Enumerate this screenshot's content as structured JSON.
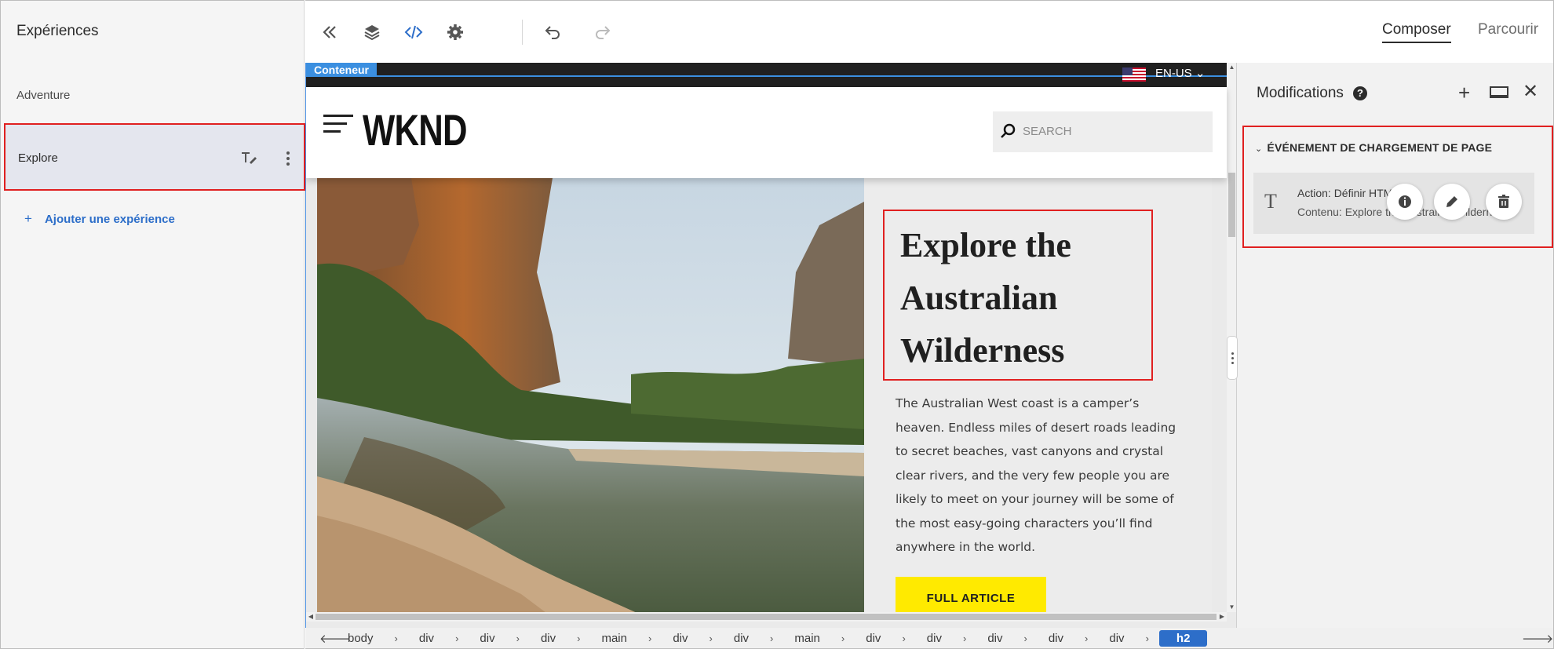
{
  "left_panel": {
    "title": "Expériences",
    "experiences": [
      "Adventure",
      "Explore"
    ],
    "add_label": "Ajouter une expérience"
  },
  "toolbar": {
    "icons": [
      "collapse-icon",
      "layers-icon",
      "code-icon",
      "settings-icon",
      "undo-icon",
      "redo-icon"
    ],
    "tabs": {
      "compose": "Composer",
      "browse": "Parcourir"
    }
  },
  "canvas": {
    "container_tag": "Conteneur",
    "language": "EN-US",
    "site": {
      "logo": "WKND",
      "search_placeholder": "SEARCH",
      "headline": "Explore the Australian Wilderness",
      "body": "The Australian West coast is a camper’s heaven. Endless miles of desert roads leading to secret beaches, vast canyons and crystal clear rivers, and the very few people you are likely to meet on your journey will be some of the most easy-going characters you’ll find anywhere in the world.",
      "cta": "FULL ARTICLE"
    }
  },
  "breadcrumb": {
    "items": [
      "body",
      "div",
      "div",
      "div",
      "main",
      "div",
      "div",
      "main",
      "div",
      "div",
      "div",
      "div",
      "div"
    ],
    "active": "h2"
  },
  "right_panel": {
    "title": "Modifications",
    "event_header": "ÉVÉNEMENT DE CHARGEMENT DE PAGE",
    "action_line": "Action: Définir HTML",
    "content_line": "Contenu: Explore the Australian Wilderness"
  },
  "colors": {
    "accent_blue": "#2d6ec9",
    "highlight_red": "#e02020",
    "cta_yellow": "#ffea00",
    "container_blue": "#3b8fe0"
  }
}
